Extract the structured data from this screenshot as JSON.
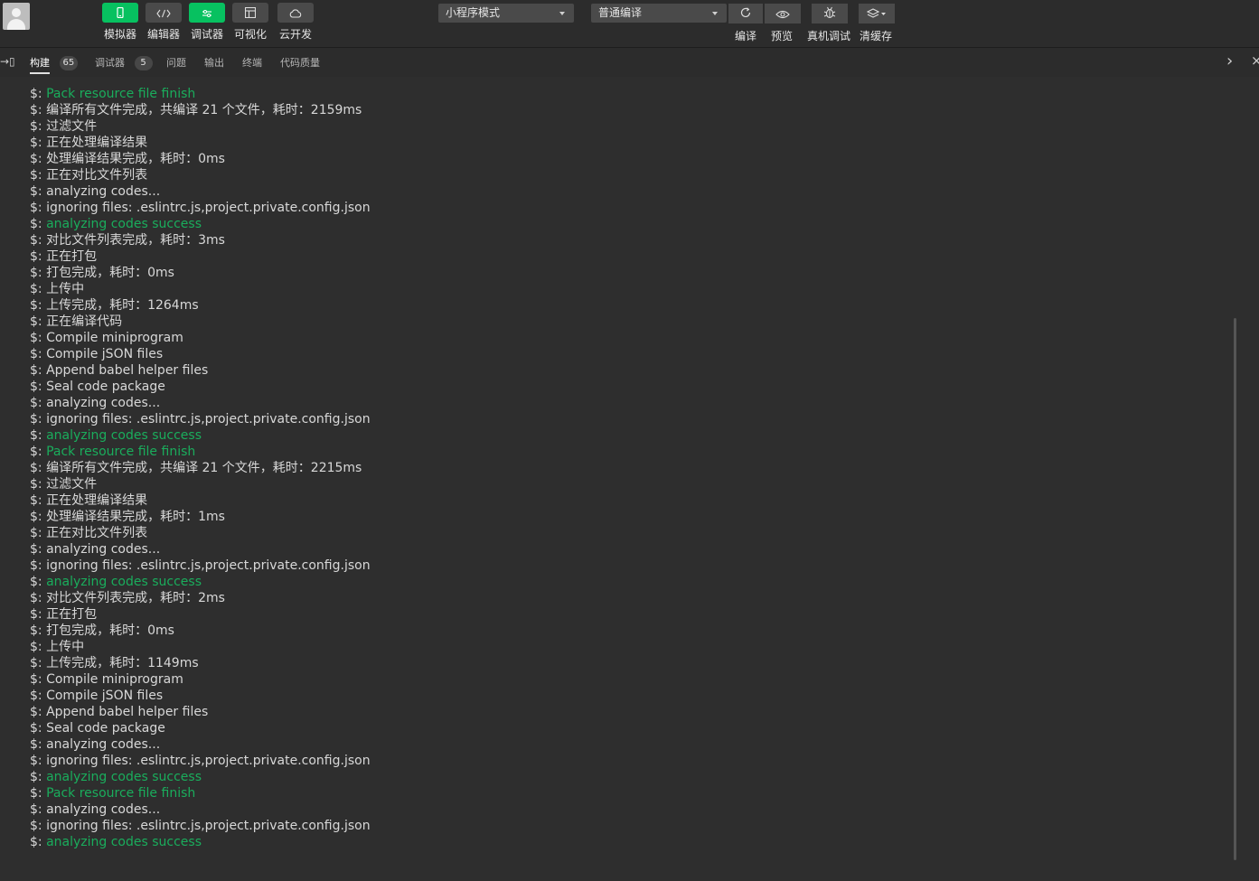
{
  "toolbar": {
    "tools": [
      {
        "label": "模拟器",
        "icon": "phone-icon"
      },
      {
        "label": "编辑器",
        "icon": "code-icon"
      },
      {
        "label": "调试器",
        "icon": "debugger-icon"
      },
      {
        "label": "可视化",
        "icon": "layout-icon"
      },
      {
        "label": "云开发",
        "icon": "cloud-icon"
      }
    ],
    "mode_select": "小程序模式",
    "compile_select": "普通编译",
    "actions": [
      {
        "label": "编译",
        "icon": "refresh-icon"
      },
      {
        "label": "预览",
        "icon": "eye-icon"
      },
      {
        "label": "真机调试",
        "icon": "bug-icon"
      },
      {
        "label": "清缓存",
        "icon": "layers-icon"
      }
    ]
  },
  "tabs": [
    {
      "label": "构建",
      "badge": "65",
      "active": true
    },
    {
      "label": "调试器",
      "badge": "5"
    },
    {
      "label": "问题"
    },
    {
      "label": "输出"
    },
    {
      "label": "终端"
    },
    {
      "label": "代码质量"
    }
  ],
  "tab_controls": {
    "expand": "→▯",
    "next": "›",
    "close": "×"
  },
  "console": {
    "prompt": "$:",
    "lines": [
      {
        "text": "Pack resource file finish",
        "success": true
      },
      {
        "text": "编译所有文件完成，共编译 21 个文件，耗时：2159ms"
      },
      {
        "text": "过滤文件"
      },
      {
        "text": "正在处理编译结果"
      },
      {
        "text": "处理编译结果完成，耗时：0ms"
      },
      {
        "text": "正在对比文件列表"
      },
      {
        "text": "analyzing codes..."
      },
      {
        "text": "ignoring files: .eslintrc.js,project.private.config.json"
      },
      {
        "text": "analyzing codes success",
        "success": true
      },
      {
        "text": "对比文件列表完成，耗时：3ms"
      },
      {
        "text": "正在打包"
      },
      {
        "text": "打包完成，耗时：0ms"
      },
      {
        "text": "上传中"
      },
      {
        "text": "上传完成，耗时：1264ms"
      },
      {
        "text": "正在编译代码"
      },
      {
        "text": "Compile miniprogram"
      },
      {
        "text": "Compile jSON files"
      },
      {
        "text": "Append babel helper files"
      },
      {
        "text": "Seal code package"
      },
      {
        "text": "analyzing codes..."
      },
      {
        "text": "ignoring files: .eslintrc.js,project.private.config.json"
      },
      {
        "text": "analyzing codes success",
        "success": true
      },
      {
        "text": "Pack resource file finish",
        "success": true
      },
      {
        "text": "编译所有文件完成，共编译 21 个文件，耗时：2215ms"
      },
      {
        "text": "过滤文件"
      },
      {
        "text": "正在处理编译结果"
      },
      {
        "text": "处理编译结果完成，耗时：1ms"
      },
      {
        "text": "正在对比文件列表"
      },
      {
        "text": "analyzing codes..."
      },
      {
        "text": "ignoring files: .eslintrc.js,project.private.config.json"
      },
      {
        "text": "analyzing codes success",
        "success": true
      },
      {
        "text": "对比文件列表完成，耗时：2ms"
      },
      {
        "text": "正在打包"
      },
      {
        "text": "打包完成，耗时：0ms"
      },
      {
        "text": "上传中"
      },
      {
        "text": "上传完成，耗时：1149ms"
      },
      {
        "text": "Compile miniprogram"
      },
      {
        "text": "Compile jSON files"
      },
      {
        "text": "Append babel helper files"
      },
      {
        "text": "Seal code package"
      },
      {
        "text": "analyzing codes..."
      },
      {
        "text": "ignoring files: .eslintrc.js,project.private.config.json"
      },
      {
        "text": "analyzing codes success",
        "success": true
      },
      {
        "text": "Pack resource file finish",
        "success": true
      },
      {
        "text": "analyzing codes..."
      },
      {
        "text": "ignoring files: .eslintrc.js,project.private.config.json"
      },
      {
        "text": "analyzing codes success",
        "success": true
      }
    ]
  },
  "colors": {
    "success": "#1aad5c",
    "accent": "#07c160",
    "background": "#2e2e2e"
  }
}
